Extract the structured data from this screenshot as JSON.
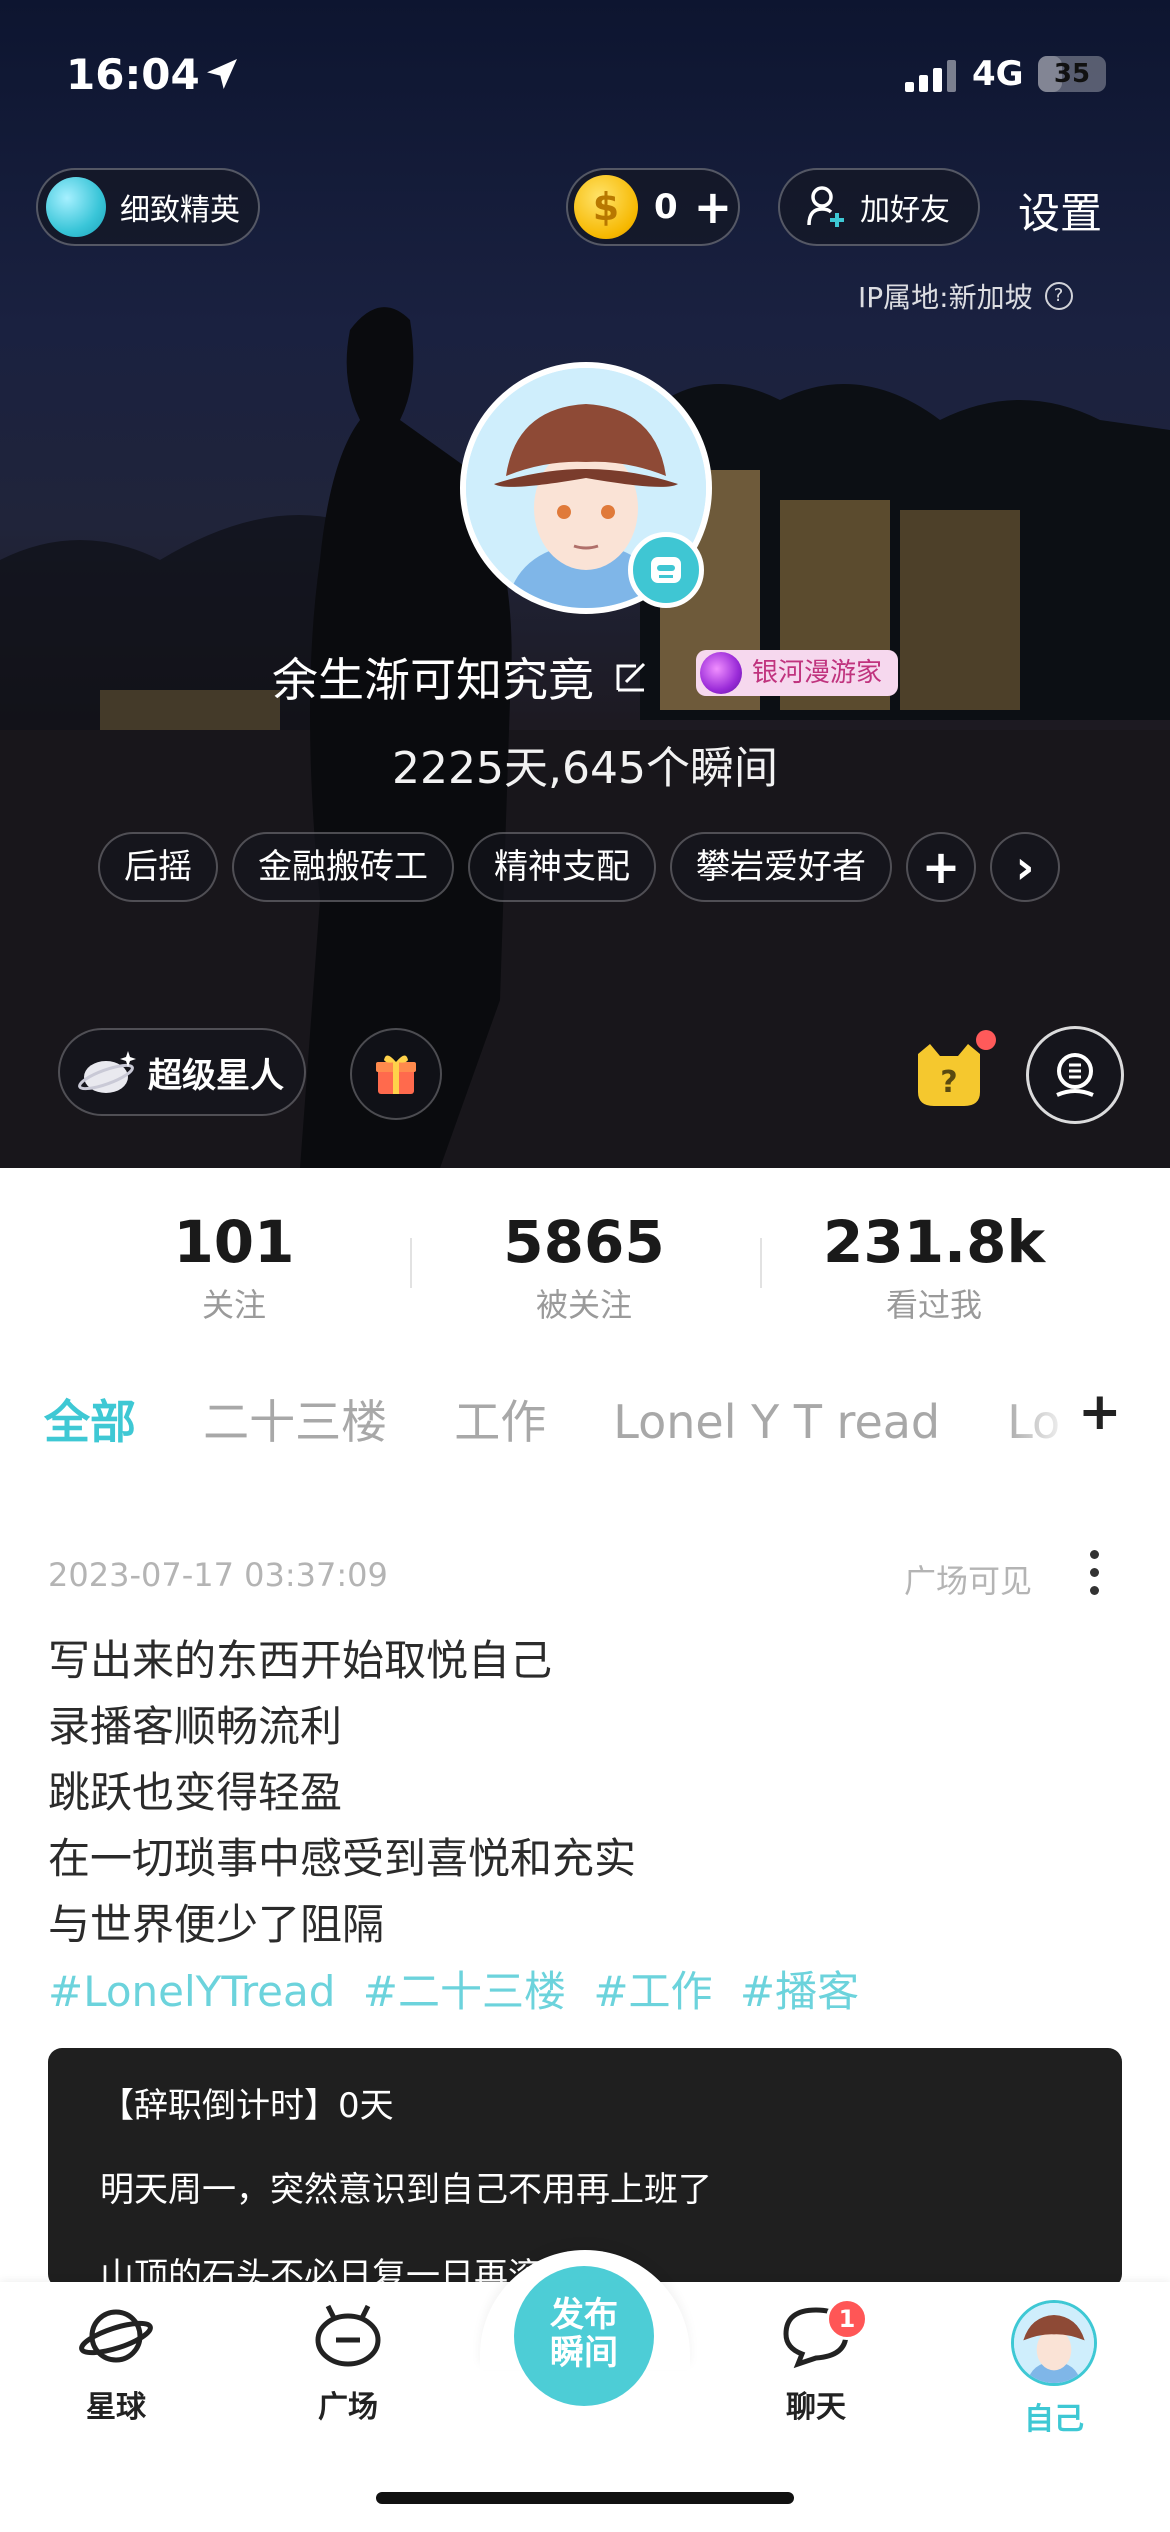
{
  "status_bar": {
    "time": "16:04",
    "network": "4G",
    "battery": "35"
  },
  "header": {
    "level_label": "细致精英",
    "coin_count": "0",
    "coin_symbol": "$",
    "coin_plus": "+",
    "add_friend_label": "加好友",
    "settings_label": "设置",
    "ip_location": "IP属地:新加坡",
    "ip_help": "?"
  },
  "profile": {
    "nickname": "余生渐可知究竟",
    "title_badge": "银河漫游家",
    "summary": "2225天,645个瞬间",
    "tags": [
      "后摇",
      "金融搬砖工",
      "精神支配",
      "攀岩爱好者"
    ],
    "tag_add": "+",
    "tag_more": "›",
    "super_label": "超级星人"
  },
  "stats": [
    {
      "value": "101",
      "label": "关注"
    },
    {
      "value": "5865",
      "label": "被关注"
    },
    {
      "value": "231.8k",
      "label": "看过我"
    }
  ],
  "category_tabs": {
    "items": [
      "全部",
      "二十三楼",
      "工作",
      "Lonel Y T read",
      "Lo"
    ],
    "active": 0,
    "add": "+"
  },
  "post": {
    "timestamp": "2023-07-17 03:37:09",
    "visibility": "广场可见",
    "lines": [
      "写出来的东西开始取悦自己",
      "录播客顺畅流利",
      "跳跃也变得轻盈",
      "在一切琐事中感受到喜悦和充实",
      "与世界便少了阻隔"
    ],
    "hashtags": [
      "#LonelYTread",
      "#二十三楼",
      "#工作",
      "#播客"
    ],
    "quote": {
      "line1": "【辞职倒计时】0天",
      "line2": "明天周一，突然意识到自己不用再上班了",
      "line3": "山顶的石头不必日复一日再滚"
    }
  },
  "bottom_nav": {
    "planet": "星球",
    "square": "广场",
    "publish": "发布\n瞬间",
    "chat": "聊天",
    "chat_badge": "1",
    "me": "自己"
  },
  "colors": {
    "accent": "#3ec8d4",
    "hashtag": "#6cd3dc",
    "badge_red": "#ff5656"
  }
}
